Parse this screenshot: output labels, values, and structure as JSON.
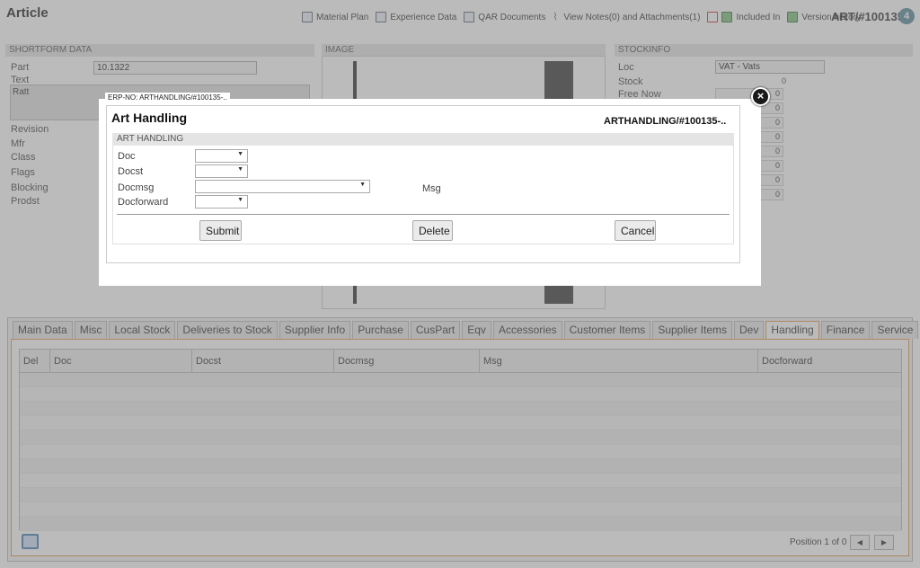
{
  "header": {
    "title": "Article",
    "record_id": "ART/#100135",
    "record_count": "4",
    "toolbar": [
      {
        "label": "Material Plan",
        "icon": "material-plan-icon"
      },
      {
        "label": "Experience Data",
        "icon": "experience-data-icon"
      },
      {
        "label": "QAR Documents",
        "icon": "qar-documents-icon"
      },
      {
        "label": "View Notes(0) and Attachments(1)",
        "icon": "paperclip-icon"
      },
      {
        "label": "Included In",
        "icon": "included-in-icon"
      },
      {
        "label": "Version history",
        "icon": "version-history-icon"
      }
    ]
  },
  "shortform": {
    "heading": "SHORTFORM DATA",
    "part_label": "Part",
    "part_value": "10.1322",
    "text_label": "Text",
    "text_value": "Ratt",
    "labels": [
      "Revision",
      "Mfr",
      "Class",
      "Flags",
      "Blocking",
      "Prodst"
    ]
  },
  "image_panel": {
    "heading": "IMAGE"
  },
  "stockinfo": {
    "heading": "STOCKINFO",
    "loc_label": "Loc",
    "loc_value": "VAT - Vats",
    "stock_label": "Stock",
    "stock_value": "0",
    "free_now_label": "Free Now",
    "values": [
      "0",
      "0",
      "0",
      "0",
      "0",
      "0",
      "0",
      "0"
    ]
  },
  "tabs": [
    "Main Data",
    "Misc",
    "Local Stock",
    "Deliveries to Stock",
    "Supplier Info",
    "Purchase",
    "CusPart",
    "Eqv",
    "Accessories",
    "Customer Items",
    "Supplier Items",
    "Dev",
    "Handling",
    "Finance",
    "Service"
  ],
  "active_tab": "Handling",
  "grid": {
    "columns": [
      "Del",
      "Doc",
      "Docst",
      "Docmsg",
      "Msg",
      "Docforward"
    ],
    "pager": "Position 1 of 0"
  },
  "dialog": {
    "caption": "ERP-NO: ARTHANDLING/#100135-..",
    "title": "Art Handling",
    "ref": "ARTHANDLING/#100135-..",
    "section": "ART HANDLING",
    "fields": {
      "doc": "Doc",
      "docst": "Docst",
      "docmsg": "Docmsg",
      "msg": "Msg",
      "docforward": "Docforward"
    },
    "buttons": {
      "submit": "Submit",
      "delete": "Delete",
      "cancel": "Cancel"
    }
  }
}
